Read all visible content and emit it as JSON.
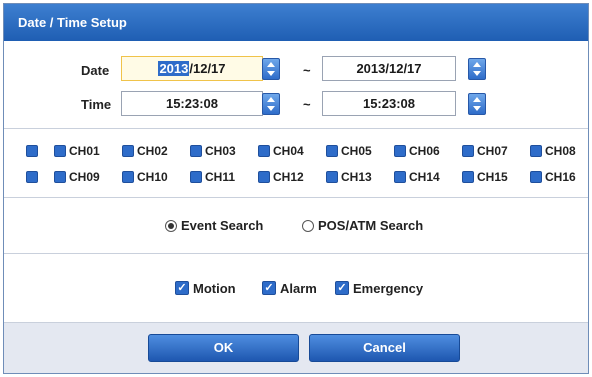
{
  "dialog": {
    "title": "Date / Time Setup"
  },
  "date": {
    "label": "Date",
    "start_selected": "2013",
    "start_rest": "/12/17",
    "end": "2013/12/17",
    "separator": "~"
  },
  "time": {
    "label": "Time",
    "start": "15:23:08",
    "end": "15:23:08",
    "separator": "~"
  },
  "channels": {
    "row1": [
      "CH01",
      "CH02",
      "CH03",
      "CH04",
      "CH05",
      "CH06",
      "CH07",
      "CH08"
    ],
    "row2": [
      "CH09",
      "CH10",
      "CH11",
      "CH12",
      "CH13",
      "CH14",
      "CH15",
      "CH16"
    ]
  },
  "search_mode": {
    "options": [
      "Event Search",
      "POS/ATM Search"
    ],
    "selected": "Event Search"
  },
  "event_types": {
    "items": [
      "Motion",
      "Alarm",
      "Emergency"
    ],
    "check_glyph": "✓"
  },
  "buttons": {
    "ok": "OK",
    "cancel": "Cancel"
  },
  "colors": {
    "accent": "#2e6cc9",
    "title_bar": "#2a6ac2",
    "active_field": "#f0c34a"
  }
}
